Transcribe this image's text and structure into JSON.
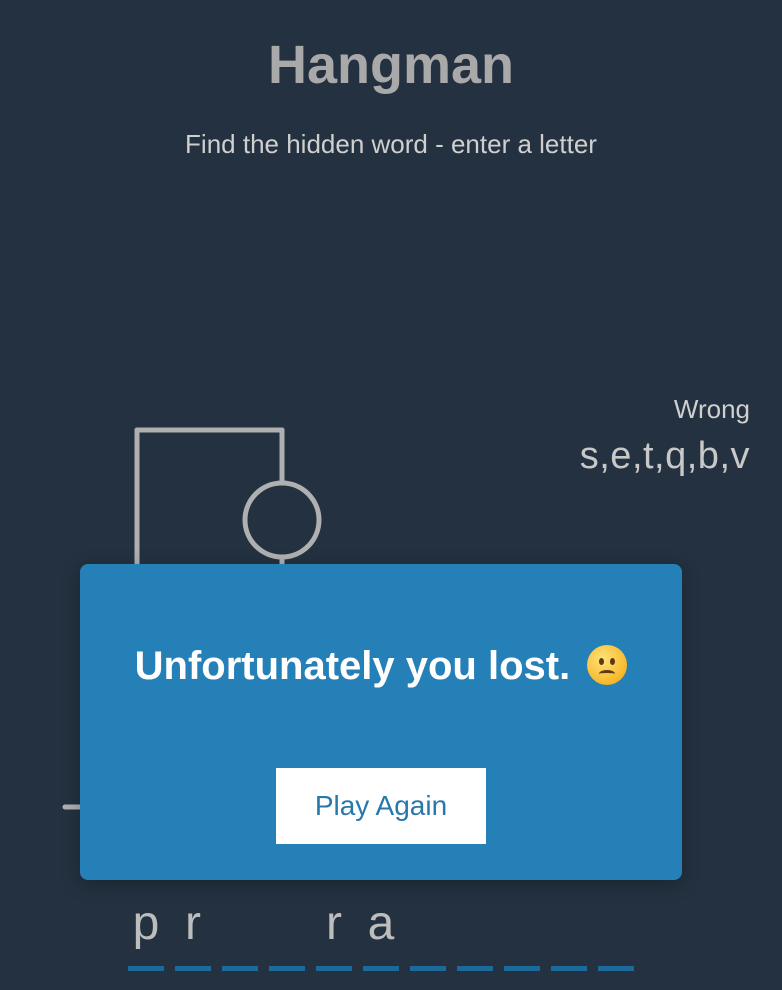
{
  "header": {
    "title": "Hangman",
    "subtitle": "Find the hidden word - enter a letter"
  },
  "wrong": {
    "label": "Wrong",
    "letters": "s,e,t,q,b,v"
  },
  "word": {
    "letters": [
      "p",
      "r",
      "",
      "",
      "r",
      "a",
      "",
      "",
      "",
      "",
      ""
    ]
  },
  "modal": {
    "message": "Unfortunately you lost.",
    "emoji": "confused-face-icon",
    "button_label": "Play Again"
  },
  "colors": {
    "background": "#233140",
    "modal": "#2680b8",
    "underline": "#1c6a9a",
    "figure": "#b0b0b0"
  }
}
